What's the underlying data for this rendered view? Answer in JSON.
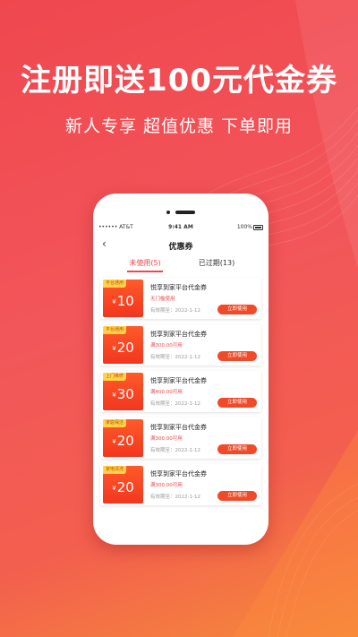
{
  "promo": {
    "title": "注册即送100元代金券",
    "subtitle": "新人专享  超值优惠  下单即用"
  },
  "status_bar": {
    "carrier": "•••••• AT&T",
    "time": "9:41 AM",
    "battery": "100%"
  },
  "nav": {
    "back_icon": "chevron-left",
    "title": "优惠券"
  },
  "tabs": [
    {
      "label": "未使用(5)",
      "active": true
    },
    {
      "label": "已过期(13)",
      "active": false
    }
  ],
  "coupons": [
    {
      "tag": "平台通用",
      "currency": "¥",
      "amount": "10",
      "title": "悦享到家平台代金券",
      "condition": "无门槛使用",
      "expiry": "有效期至：2022-1-12",
      "button": "立即使用"
    },
    {
      "tag": "平台通用",
      "currency": "¥",
      "amount": "20",
      "title": "悦享到家平台代金券",
      "condition": "满300.00可用",
      "expiry": "有效期至：2022-1-12",
      "button": "立即使用"
    },
    {
      "tag": "上门维修",
      "currency": "¥",
      "amount": "30",
      "title": "悦享到家平台代金券",
      "condition": "满400.00可用",
      "expiry": "有效期至：2022-1-12",
      "button": "立即使用"
    },
    {
      "tag": "家庭保洁",
      "currency": "¥",
      "amount": "20",
      "title": "悦享到家平台代金券",
      "condition": "满300.00可用",
      "expiry": "有效期至：2022-1-12",
      "button": "立即使用"
    },
    {
      "tag": "家电清洗",
      "currency": "¥",
      "amount": "20",
      "title": "悦享到家平台代金券",
      "condition": "满300.00可用",
      "expiry": "有效期至：2022-1-12",
      "button": "立即使用"
    }
  ],
  "colors": {
    "accent": "#f0454a",
    "coupon_red": "#f2361f",
    "tag_yellow": "#ffd24a"
  }
}
